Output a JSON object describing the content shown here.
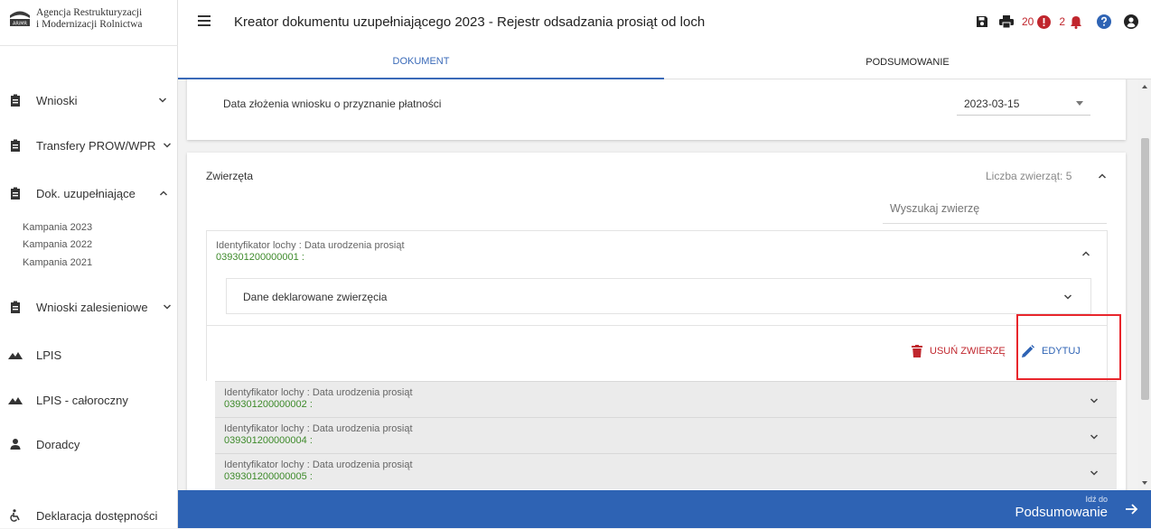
{
  "logo": {
    "line1": "Agencja Restrukturyzacji",
    "line2": "i Modernizacji Rolnictwa",
    "mark_text": "ARiMR"
  },
  "sidebar": {
    "items": [
      {
        "label": "Wnioski"
      },
      {
        "label": "Transfery PROW/WPR"
      },
      {
        "label": "Dok. uzupełniające"
      },
      {
        "label": "Wnioski zalesieniowe"
      },
      {
        "label": "LPIS"
      },
      {
        "label": "LPIS - całoroczny"
      },
      {
        "label": "Doradcy"
      },
      {
        "label": "Deklaracja dostępności"
      }
    ],
    "subitems": [
      "Kampania 2023",
      "Kampania 2022",
      "Kampania 2021"
    ]
  },
  "header": {
    "title": "Kreator dokumentu uzupełniającego 2023 - Rejestr odsadzania prosiąt od loch",
    "error_count": "20",
    "alert_count": "2"
  },
  "tabs": [
    "DOKUMENT",
    "PODSUMOWANIE"
  ],
  "date_field": {
    "label": "Data złożenia wniosku o przyznanie płatności",
    "value": "2023-03-15"
  },
  "animals": {
    "title": "Zwierzęta",
    "count_label": "Liczba zwierząt: 5",
    "search_placeholder": "Wyszukaj zwierzę",
    "entry_label": "Identyfikator lochy : Data urodzenia prosiąt",
    "expanded": {
      "id": "039301200000001 :",
      "sub_label": "Dane deklarowane zwierzęcia"
    },
    "delete_label": "USUŃ ZWIERZĘ",
    "edit_label": "EDYTUJ",
    "rows": [
      {
        "id": "039301200000002 :"
      },
      {
        "id": "039301200000004 :"
      },
      {
        "id": "039301200000005 :"
      }
    ]
  },
  "footer": {
    "small": "Idź do",
    "big": "Podsumowanie"
  },
  "colors": {
    "primary": "#2e63b4",
    "danger": "#c0262d",
    "green": "#3d8a2a",
    "highlight": "#e8262c"
  }
}
